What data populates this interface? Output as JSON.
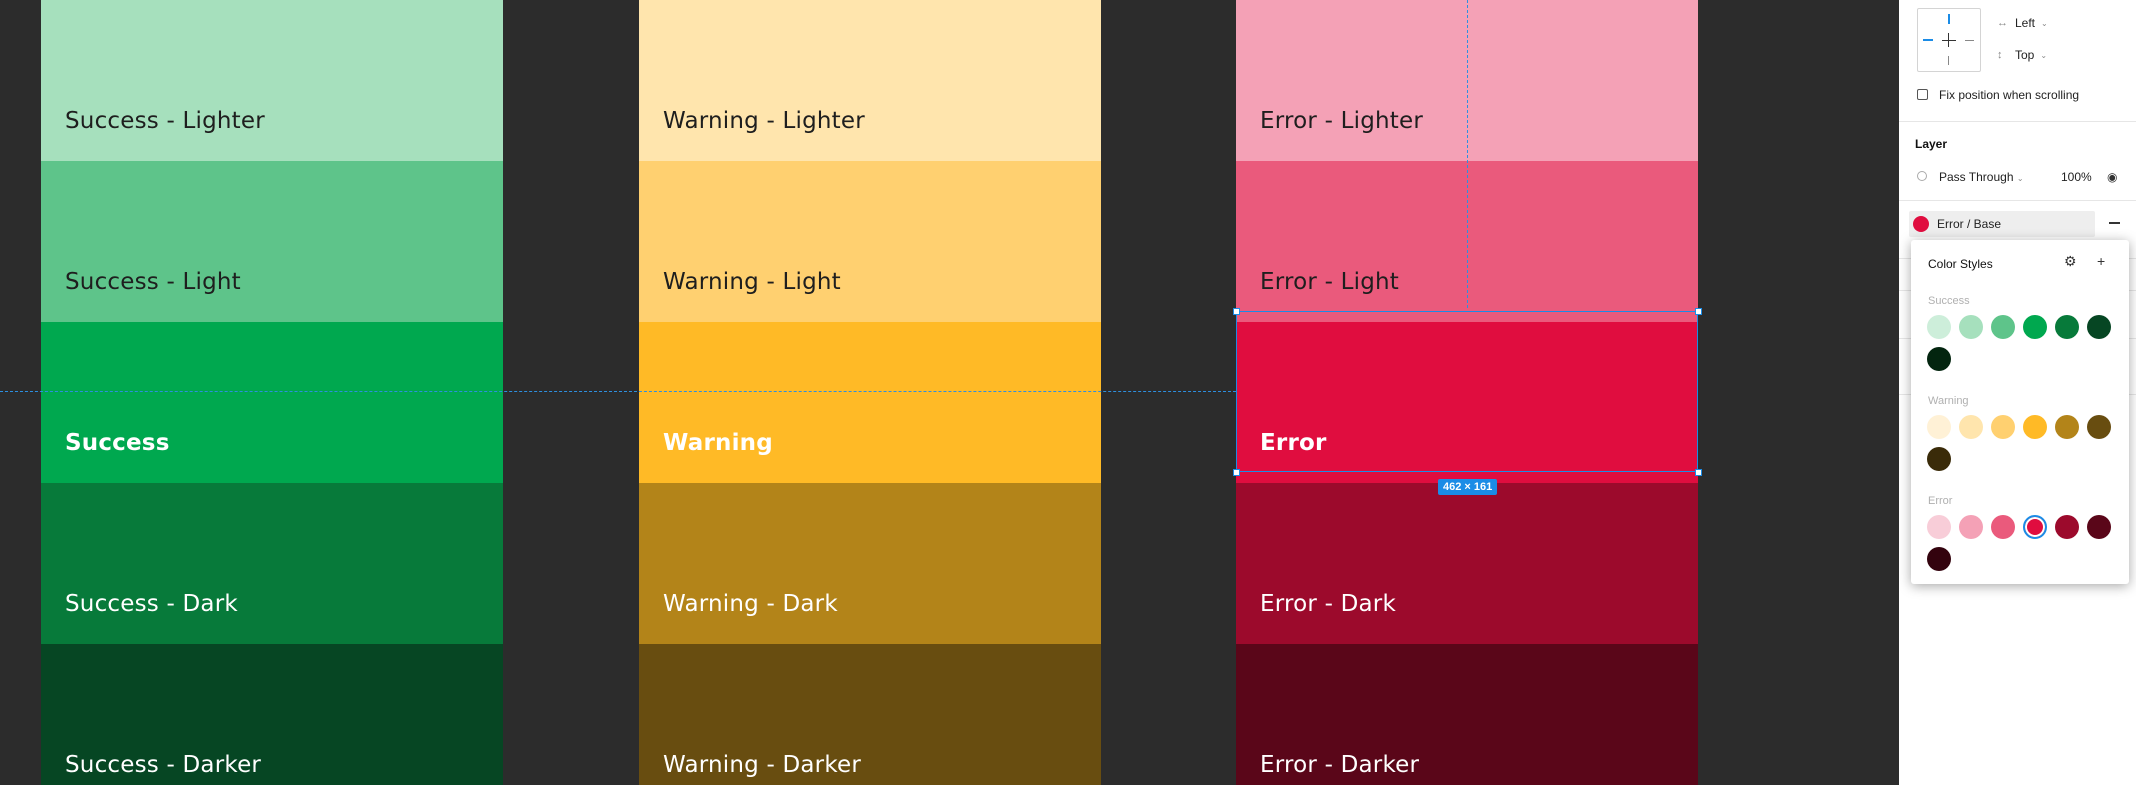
{
  "canvas": {
    "columns": [
      {
        "group": "success",
        "swatches": [
          {
            "label": "Success - Lighter",
            "color": "#a6e0bd",
            "text": "#1e1e1e",
            "bold": false
          },
          {
            "label": "Success - Light",
            "color": "#5ec48a",
            "text": "#1e1e1e",
            "bold": false
          },
          {
            "label": "Success",
            "color": "#00a84f",
            "text": "#ffffff",
            "bold": true
          },
          {
            "label": "Success - Dark",
            "color": "#077a3a",
            "text": "#ffffff",
            "bold": false
          },
          {
            "label": "Success - Darker",
            "color": "#064623",
            "text": "#ffffff",
            "bold": false
          }
        ]
      },
      {
        "group": "warning",
        "swatches": [
          {
            "label": "Warning - Lighter",
            "color": "#ffe5ad",
            "text": "#1e1e1e",
            "bold": false
          },
          {
            "label": "Warning - Light",
            "color": "#ffd070",
            "text": "#1e1e1e",
            "bold": false
          },
          {
            "label": "Warning",
            "color": "#ffba26",
            "text": "#ffffff",
            "bold": true
          },
          {
            "label": "Warning - Dark",
            "color": "#b38419",
            "text": "#ffffff",
            "bold": false
          },
          {
            "label": "Warning - Darker",
            "color": "#684d10",
            "text": "#ffffff",
            "bold": false
          }
        ]
      },
      {
        "group": "error",
        "swatches": [
          {
            "label": "Error - Lighter",
            "color": "#f4a1b6",
            "text": "#1e1e1e",
            "bold": false
          },
          {
            "label": "Error - Light",
            "color": "#ea5a7c",
            "text": "#1e1e1e",
            "bold": false
          },
          {
            "label": "Error",
            "color": "#e00d3f",
            "text": "#ffffff",
            "bold": true
          },
          {
            "label": "Error - Dark",
            "color": "#9c0a2c",
            "text": "#ffffff",
            "bold": false
          },
          {
            "label": "Error - Darker",
            "color": "#5a0619",
            "text": "#ffffff",
            "bold": false
          }
        ]
      }
    ],
    "selection_size": "462 × 161"
  },
  "panel": {
    "constraints": {
      "horizontal": "Left",
      "vertical": "Top"
    },
    "fix_position_label": "Fix position when scrolling",
    "layer": {
      "title": "Layer",
      "blend_mode": "Pass Through",
      "opacity": "100%"
    },
    "fill": {
      "style_name": "Error / Base",
      "color": "#e00d3f"
    },
    "color_styles": {
      "title": "Color Styles",
      "groups": [
        {
          "name": "Success",
          "colors": [
            "#cdeeda",
            "#a6e0bd",
            "#5ec48a",
            "#00a84f",
            "#077a3a",
            "#064623",
            "#03250f"
          ]
        },
        {
          "name": "Warning",
          "colors": [
            "#fff1d6",
            "#ffe5ad",
            "#ffd070",
            "#ffba26",
            "#b38419",
            "#684d10",
            "#3a2b09"
          ]
        },
        {
          "name": "Error",
          "colors": [
            "#f8cdd8",
            "#f4a1b6",
            "#ea5a7c",
            "#e00d3f",
            "#9c0a2c",
            "#5a0619",
            "#33030e"
          ],
          "selected_index": 3
        }
      ]
    }
  }
}
